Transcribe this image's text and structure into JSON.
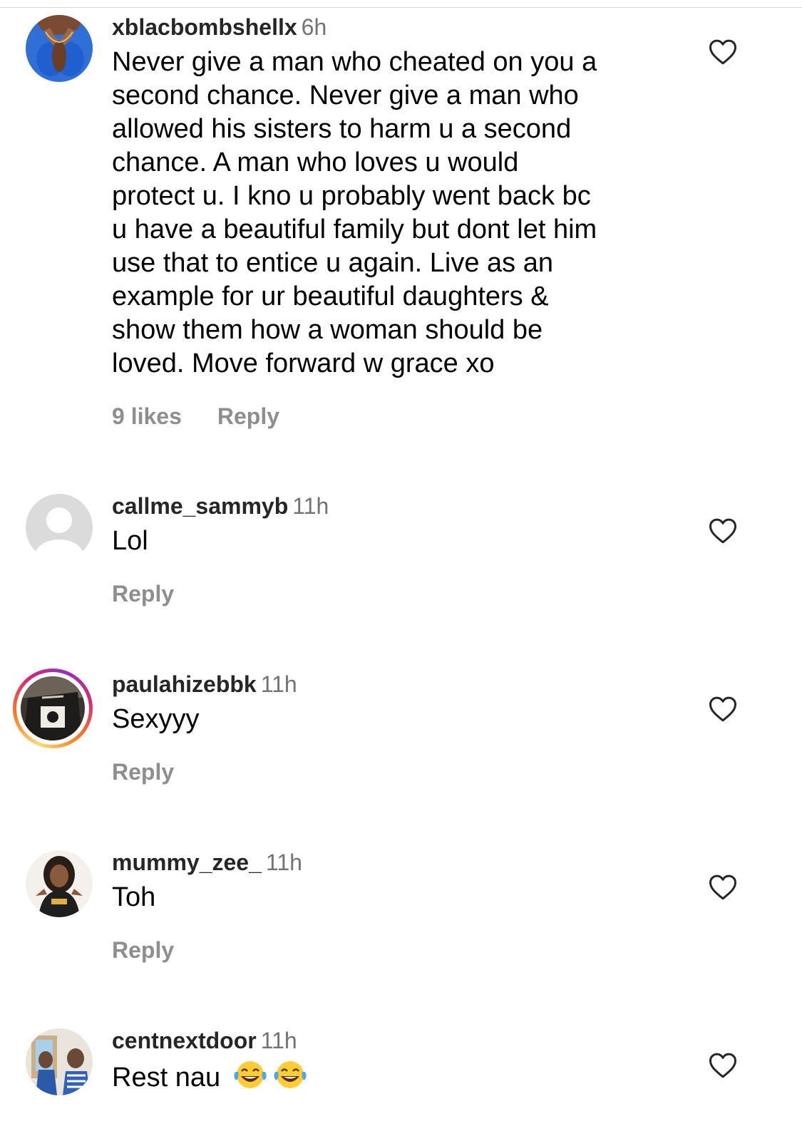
{
  "comments": [
    {
      "username": "xblacbombshellx",
      "time": "6h",
      "text_lines": [
        "Never give a man who cheated on you a",
        "second chance. Never give a man who",
        "allowed his sisters to harm u a second",
        "chance. A man who loves u would",
        "protect u. I kno u probably went back bc",
        "u have a beautiful family but dont let him",
        "use that to entice u again. Live as an",
        "example for ur beautiful daughters &",
        "show them how a woman should be",
        "loved. Move forward w grace xo"
      ],
      "likes": "9 likes",
      "reply": "Reply",
      "avatar_icon": "profile-photo-blue",
      "heart_icon": "heart-outline-icon"
    },
    {
      "username": "callme_sammyb",
      "time": "11h",
      "text": "Lol",
      "reply": "Reply",
      "avatar_icon": "default-profile-icon",
      "heart_icon": "heart-outline-icon"
    },
    {
      "username": "paulahizebbk",
      "time": "11h",
      "text": "Sexyyy",
      "reply": "Reply",
      "avatar_icon": "profile-photo-story-ring",
      "heart_icon": "heart-outline-icon"
    },
    {
      "username": "mummy_zee_",
      "time": "11h",
      "text": "Toh",
      "reply": "Reply",
      "avatar_icon": "profile-photo-woman",
      "heart_icon": "heart-outline-icon"
    },
    {
      "username": "centnextdoor",
      "time": "11h",
      "text": "Rest nau",
      "emojis": [
        "tears-of-joy-emoji",
        "tears-of-joy-emoji"
      ],
      "avatar_icon": "profile-photo-men",
      "heart_icon": "heart-outline-icon"
    }
  ],
  "colors": {
    "username": "#262626",
    "meta": "#737373",
    "action": "#8e8e8e",
    "story_ring": [
      "#feda75",
      "#fa7e1e",
      "#d62976",
      "#962fbf"
    ]
  }
}
